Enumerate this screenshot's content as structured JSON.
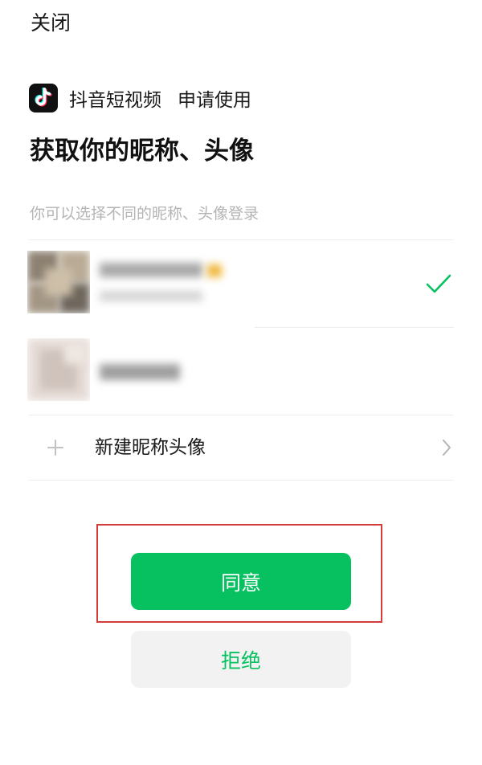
{
  "header": {
    "close_label": "关闭"
  },
  "app": {
    "name": "抖音短视频",
    "request_text": "申请使用",
    "logo_icon": "tiktok-logo-icon"
  },
  "page": {
    "title": "获取你的昵称、头像",
    "subtitle": "你可以选择不同的昵称、头像登录"
  },
  "accounts": [
    {
      "selected": true
    },
    {
      "selected": false
    }
  ],
  "new_profile": {
    "label": "新建昵称头像",
    "plus_icon": "plus-icon",
    "chevron_icon": "chevron-right-icon"
  },
  "actions": {
    "agree_label": "同意",
    "reject_label": "拒绝"
  },
  "colors": {
    "primary_green": "#07c160",
    "highlight_red": "#d43c3c",
    "secondary_button_bg": "#f2f2f2",
    "hint_gray": "#b4b4b4"
  }
}
